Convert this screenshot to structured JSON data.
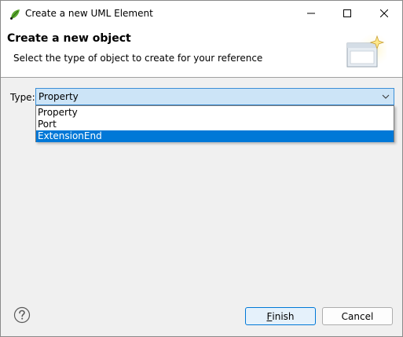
{
  "window": {
    "title": "Create a new UML Element"
  },
  "banner": {
    "title": "Create a new object",
    "description": "Select the type of object to create for your reference",
    "icon": "wizard-window-sparkle-icon"
  },
  "form": {
    "type_label": "Type:",
    "type_value": "Property",
    "options": [
      "Property",
      "Port",
      "ExtensionEnd"
    ],
    "highlighted_option": "ExtensionEnd"
  },
  "footer": {
    "help_icon": "question-mark-icon",
    "finish_mnemonic": "F",
    "finish_rest": "inish",
    "cancel_label": "Cancel"
  },
  "colors": {
    "selection": "#0078d7",
    "combo_focus_bg": "#cce4f7",
    "dialog_bg": "#f0f0f0"
  }
}
